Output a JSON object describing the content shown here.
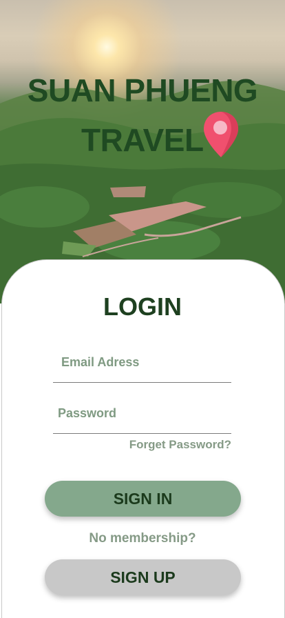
{
  "brand": {
    "line1": "SUAN PHUENG",
    "line2": "TRAVEL"
  },
  "login": {
    "title": "LOGIN",
    "email_placeholder": "Email Adress",
    "password_placeholder": "Password",
    "forget_password": "Forget Password?",
    "sign_in_label": "SIGN IN",
    "no_membership": "No membership?",
    "sign_up_label": "SIGN UP"
  },
  "colors": {
    "brand_green": "#1f4a22",
    "sign_in_bg": "#84a88c",
    "sign_up_bg": "#c8c8c8",
    "pin": "#f0506e"
  }
}
